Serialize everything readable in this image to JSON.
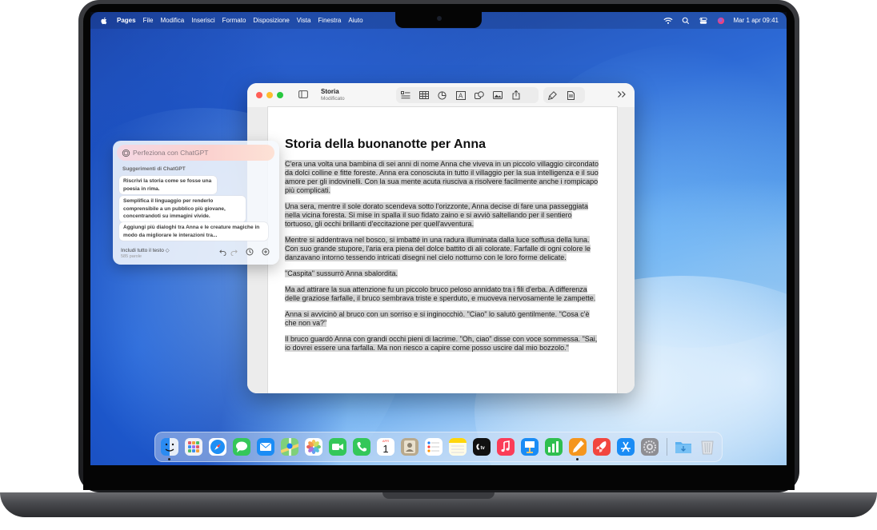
{
  "menubar": {
    "app": "Pages",
    "items": [
      "File",
      "Modifica",
      "Inserisci",
      "Formato",
      "Disposizione",
      "Vista",
      "Finestra",
      "Aiuto"
    ],
    "datetime": "Mar 1 apr  09:41"
  },
  "window": {
    "title": "Storia",
    "subtitle": "Modificato"
  },
  "document": {
    "title": "Storia della buonanotte per Anna",
    "paragraphs": [
      "C'era una volta una bambina di sei anni di nome Anna che viveva in un piccolo villaggio circondato da dolci colline e fitte foreste. Anna era conosciuta in tutto il villaggio per la sua intelligenza e il suo amore per gli indovinelli. Con la sua mente acuta riusciva a risolvere facilmente anche i rompicapo più complicati.",
      "Una sera, mentre il sole dorato scendeva sotto l'orizzonte, Anna decise di fare una passeggiata nella vicina foresta. Si mise in spalla il suo fidato zaino e si avviò saltellando per il sentiero tortuoso, gli occhi brillanti d'eccitazione per quell'avventura.",
      "Mentre si addentrava nel bosco, si imbatté in una radura illuminata dalla luce soffusa della luna. Con suo grande stupore, l'aria era piena del dolce battito di ali colorate. Farfalle di ogni colore le danzavano intorno tessendo intricati disegni nel cielo notturno con le loro forme delicate.",
      "\"Caspita\" sussurrò Anna sbalordita.",
      "Ma ad attirare la sua attenzione fu un piccolo bruco peloso annidato tra i fili d'erba. A differenza delle graziose farfalle, il bruco sembrava triste e sperduto, e muoveva nervosamente le zampette.",
      "Anna si avvicinò al bruco con un sorriso e si inginocchiò. \"Ciao\" lo salutò gentilmente. \"Cosa c'è che non va?\"",
      "Il bruco guardò Anna con grandi occhi pieni di lacrime. \"Oh, ciao\" disse con voce sommessa. \"Sai, io dovrei essere una farfalla. Ma non riesco a capire come posso uscire dal mio bozzolo.\""
    ]
  },
  "chatgpt": {
    "placeholder": "Perfeziona con ChatGPT",
    "section": "Suggerimenti di ChatGPT",
    "suggestions": [
      "Riscrivi la storia come se fosse una poesia in rima.",
      "Semplifica il linguaggio per renderlo comprensibile a un pubblico più giovane, concentrandoti su immagini vivide.",
      "Aggiungi più dialoghi tra Anna e le creature magiche in modo da migliorare le interazioni tra..."
    ],
    "include_label": "Includi tutto il testo",
    "word_count": "585 parole"
  },
  "dock": {
    "apps": [
      "Finder",
      "Launchpad",
      "Safari",
      "Messaggi",
      "Mail",
      "Mappe",
      "Foto",
      "FaceTime",
      "Telefono",
      "Calendario",
      "Contatti",
      "Promemoria",
      "Note",
      "TV",
      "Musica",
      "Keynote",
      "Numbers",
      "Pages",
      "App Store",
      "Impostazioni di Sistema",
      "Download",
      "Cestino"
    ],
    "calendar_month": "APR",
    "calendar_day": "1"
  },
  "colors": {
    "accent": "#007aff",
    "highlight": "#d4d4d4",
    "chatgpt_input": "#fbd2cf"
  }
}
